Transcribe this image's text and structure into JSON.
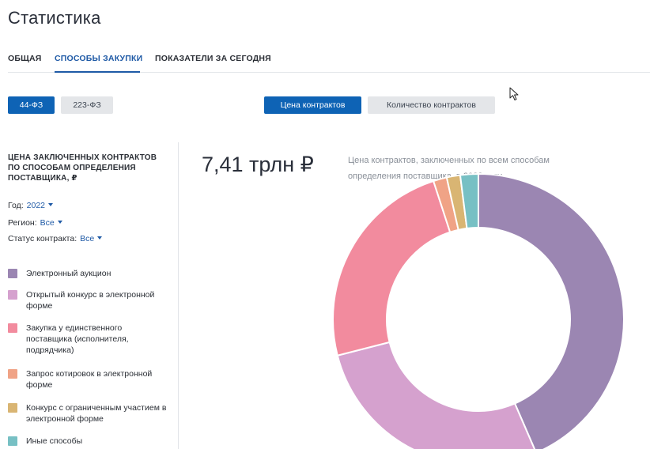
{
  "page": {
    "title": "Статистика"
  },
  "tabs": [
    {
      "label": "ОБЩАЯ",
      "active": false
    },
    {
      "label": "СПОСОБЫ ЗАКУПКИ",
      "active": true
    },
    {
      "label": "ПОКАЗАТЕЛИ ЗА СЕГОДНЯ",
      "active": false
    }
  ],
  "law_toggle": [
    {
      "label": "44-ФЗ",
      "selected": true
    },
    {
      "label": "223-ФЗ",
      "selected": false
    }
  ],
  "metric_toggle": [
    {
      "label": "Цена контрактов",
      "selected": true
    },
    {
      "label": "Количество контрактов",
      "selected": false
    }
  ],
  "filters": {
    "title": "ЦЕНА ЗАКЛЮЧЕННЫХ КОНТРАКТОВ ПО СПОСОБАМ ОПРЕДЕЛЕНИЯ ПОСТАВЩИКА, ₽",
    "year": {
      "label": "Год:",
      "value": "2022"
    },
    "region": {
      "label": "Регион:",
      "value": "Все"
    },
    "status": {
      "label": "Статус контракта:",
      "value": "Все"
    }
  },
  "summary": {
    "total": "7,41 трлн ₽",
    "caption": "Цена контрактов, заключенных по всем способам определения поставщика, в 2022 году"
  },
  "colors": {
    "accent": "#0e63b5",
    "link": "#1f5aa6"
  },
  "chart_data": {
    "type": "pie",
    "style": "donut",
    "legend_position": "left",
    "categories": [
      "Электронный аукцион",
      "Открытый конкурс в электронной форме",
      "Закупка у единственного поставщика (исполнителя, подрядчика)",
      "Запрос котировок в электронной форме",
      "Конкурс с ограниченным участием в электронной форме",
      "Иные способы"
    ],
    "values": [
      43.5,
      27.5,
      24.0,
      1.5,
      1.5,
      2.0
    ],
    "colors": [
      "#9b86b2",
      "#d5a1ce",
      "#f28b9e",
      "#f0a386",
      "#d9b573",
      "#77c0c4"
    ]
  }
}
